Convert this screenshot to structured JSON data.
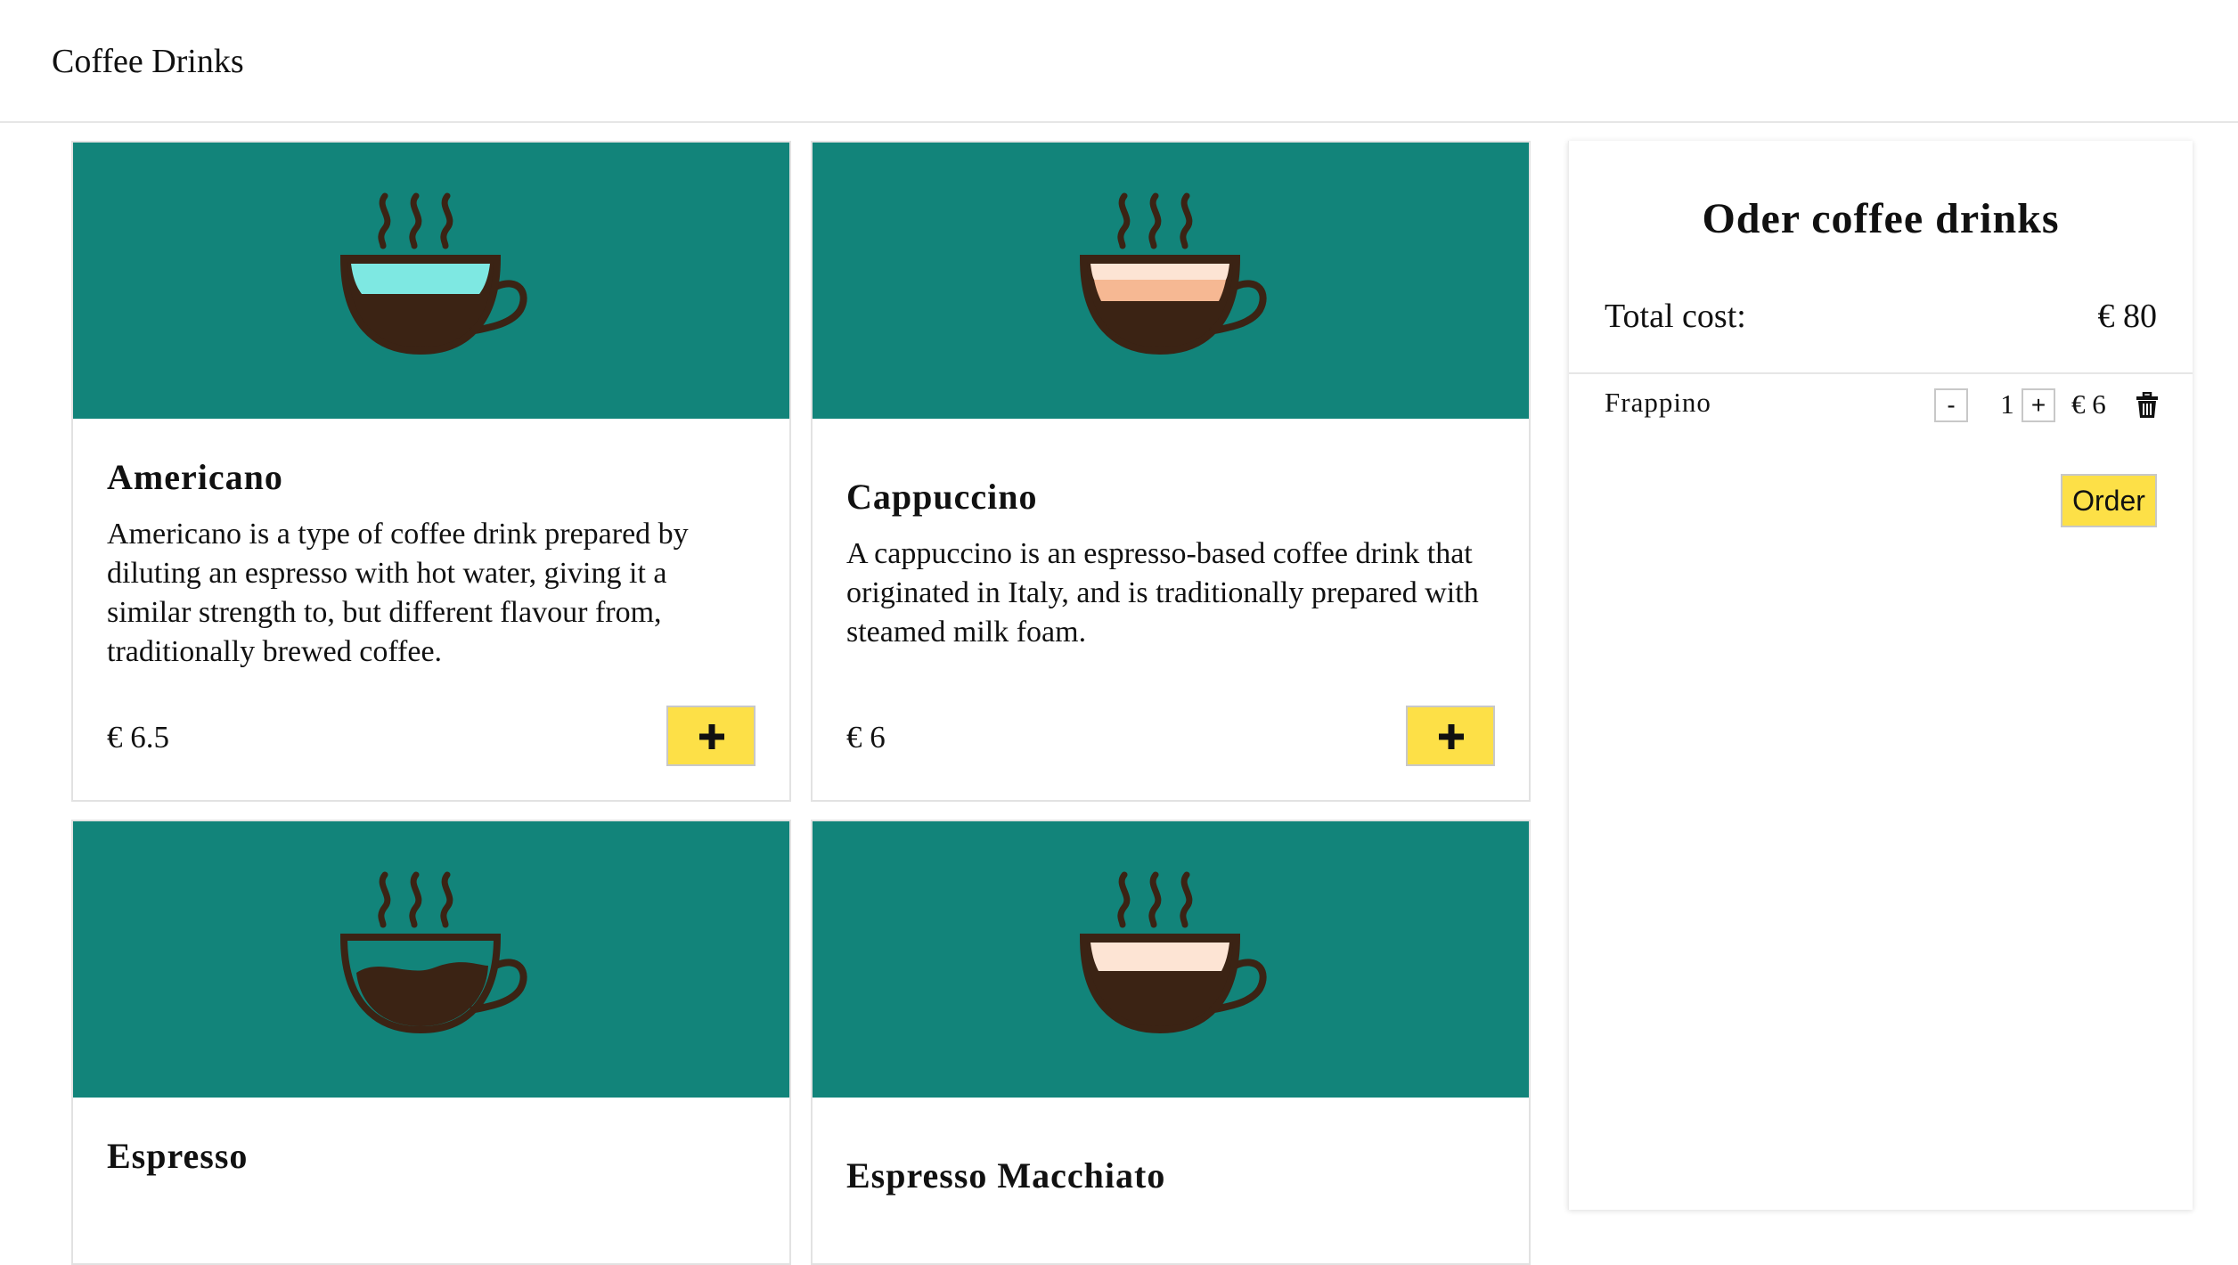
{
  "header": {
    "title": "Coffee Drinks"
  },
  "colors": {
    "card_image_bg": "#12847a",
    "add_button": "#fde047",
    "order_button": "#fde047",
    "cup_outline": "#3b2314"
  },
  "menu": {
    "add_icon": "plus-icon",
    "items": [
      {
        "name": "Americano",
        "description": "Americano is a type of coffee drink prepared by diluting an espresso with hot water, giving it a similar strength to, but different flavour from, traditionally brewed coffee.",
        "price": "€ 6.5",
        "icon": "americano-cup-icon"
      },
      {
        "name": "Cappuccino",
        "description": "A cappuccino is an espresso-based coffee drink that originated in Italy, and is traditionally prepared with steamed milk foam.",
        "price": "€ 6",
        "icon": "cappuccino-cup-icon"
      },
      {
        "name": "Espresso",
        "description": "",
        "price": "",
        "icon": "espresso-cup-icon"
      },
      {
        "name": "Espresso Macchiato",
        "description": "",
        "price": "",
        "icon": "macchiato-cup-icon"
      }
    ]
  },
  "order": {
    "title": "Oder coffee drinks",
    "total_label": "Total cost:",
    "total_value": "€ 80",
    "lines": [
      {
        "name": "Frappino",
        "decrement": "-",
        "quantity": "1",
        "increment": "+",
        "price": "€ 6",
        "delete_icon": "trash-icon"
      }
    ],
    "order_button": "Order"
  }
}
